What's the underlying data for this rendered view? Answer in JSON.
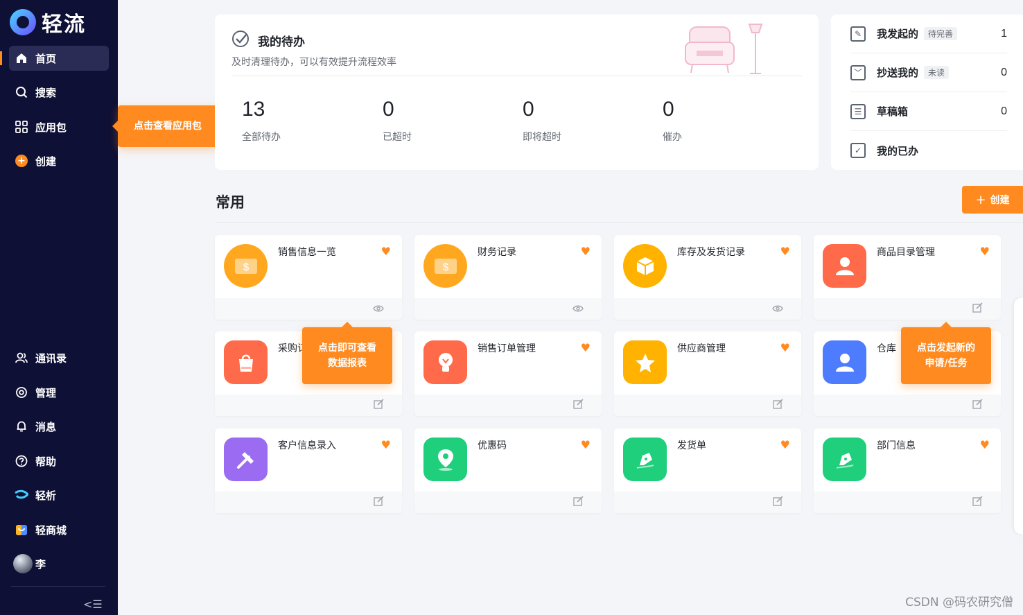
{
  "brand": {
    "name": "轻流"
  },
  "sidebar": {
    "top_items": [
      {
        "label": "首页",
        "icon": "home-icon"
      },
      {
        "label": "搜索",
        "icon": "search-icon"
      },
      {
        "label": "应用包",
        "icon": "grid-icon"
      },
      {
        "label": "创建",
        "icon": "plus-circle-icon"
      }
    ],
    "bottom_items": [
      {
        "label": "通讯录",
        "icon": "contacts-icon"
      },
      {
        "label": "管理",
        "icon": "settings-icon"
      },
      {
        "label": "消息",
        "icon": "bell-icon"
      },
      {
        "label": "帮助",
        "icon": "help-icon"
      },
      {
        "label": "轻析",
        "icon": "qingxi-icon"
      },
      {
        "label": "轻商城",
        "icon": "store-icon"
      },
      {
        "label": "李",
        "icon": "avatar"
      }
    ],
    "collapse_glyph": "<☰"
  },
  "tooltips": {
    "app_package": "点击查看应用包",
    "report": [
      "点击即可查看",
      "数据报表"
    ],
    "new_request": [
      "点击发起新的",
      "申请/任务"
    ]
  },
  "todo": {
    "title": "我的待办",
    "subtitle": "及时清理待办，可以有效提升流程效率",
    "stats": [
      {
        "value": "13",
        "label": "全部待办"
      },
      {
        "value": "0",
        "label": "已超时"
      },
      {
        "value": "0",
        "label": "即将超时"
      },
      {
        "value": "0",
        "label": "催办"
      }
    ]
  },
  "summary": [
    {
      "label": "我发起的",
      "tag": "待完善",
      "count": "1"
    },
    {
      "label": "抄送我的",
      "tag": "未读",
      "count": "0"
    },
    {
      "label": "草稿箱",
      "tag": "",
      "count": "0"
    },
    {
      "label": "我的已办",
      "tag": "",
      "count": ""
    }
  ],
  "common": {
    "title": "常用",
    "create_label": "创建"
  },
  "apps": [
    {
      "name": "销售信息一览",
      "color": "#ffa81f",
      "glyph": "$",
      "foot": "eye"
    },
    {
      "name": "财务记录",
      "color": "#ffa81f",
      "glyph": "$",
      "foot": "eye"
    },
    {
      "name": "库存及发货记录",
      "color": "#ffb300",
      "glyph": "▣",
      "foot": "eye"
    },
    {
      "name": "商品目录管理",
      "color": "#ff6b4a",
      "glyph": "👤",
      "foot": "edit"
    },
    {
      "name": "采购订",
      "color": "#ff6b4a",
      "glyph": "🛍",
      "foot": "edit"
    },
    {
      "name": "销售订单管理",
      "color": "#ff6b4a",
      "glyph": "💡",
      "foot": "edit"
    },
    {
      "name": "供应商管理",
      "color": "#ffb300",
      "glyph": "★",
      "foot": "edit"
    },
    {
      "name": "仓库",
      "color": "#4d7cff",
      "glyph": "👤",
      "foot": "edit"
    },
    {
      "name": "客户信息录入",
      "color": "#9b6bf2",
      "glyph": "⚒",
      "foot": "edit"
    },
    {
      "name": "优惠码",
      "color": "#1fcf7c",
      "glyph": "📍",
      "foot": "edit"
    },
    {
      "name": "发货单",
      "color": "#1fcf7c",
      "glyph": "✒",
      "foot": "edit"
    },
    {
      "name": "部门信息",
      "color": "#1fcf7c",
      "glyph": "✒",
      "foot": "edit"
    }
  ],
  "watermark": "CSDN @码农研究僧"
}
